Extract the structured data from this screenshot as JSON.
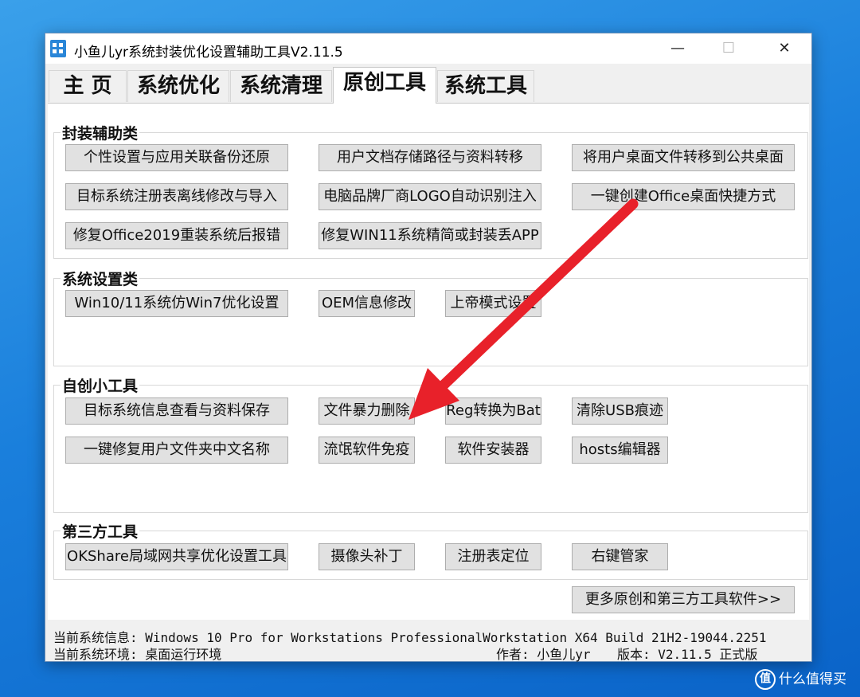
{
  "window": {
    "title": "小鱼儿yr系统封装优化设置辅助工具V2.11.5",
    "minimize_glyph": "—",
    "maximize_glyph": "☐",
    "close_glyph": "✕"
  },
  "tabs": [
    {
      "label": "主 页",
      "active": false
    },
    {
      "label": "系统优化",
      "active": false
    },
    {
      "label": "系统清理",
      "active": false
    },
    {
      "label": "原创工具",
      "active": true
    },
    {
      "label": "系统工具",
      "active": false
    }
  ],
  "groups": {
    "packaging": {
      "title": "封装辅助类",
      "buttons": [
        "个性设置与应用关联备份还原",
        "用户文档存储路径与资料转移",
        "将用户桌面文件转移到公共桌面",
        "目标系统注册表离线修改与导入",
        "电脑品牌厂商LOGO自动识别注入",
        "一键创建Office桌面快捷方式",
        "修复Office2019重装系统后报错",
        "修复WIN11系统精简或封装丢APP"
      ]
    },
    "system_settings": {
      "title": "系统设置类",
      "buttons": [
        "Win10/11系统仿Win7优化设置",
        "OEM信息修改",
        "上帝模式设置"
      ]
    },
    "own_tools": {
      "title": "自创小工具",
      "buttons": [
        "目标系统信息查看与资料保存",
        "文件暴力删除",
        "Reg转换为Bat",
        "清除USB痕迹",
        "一键修复用户文件夹中文名称",
        "流氓软件免疫",
        "软件安装器",
        "hosts编辑器"
      ]
    },
    "third_party": {
      "title": "第三方工具",
      "buttons": [
        "OKShare局域网共享优化设置工具",
        "摄像头补丁",
        "注册表定位",
        "右键管家"
      ]
    }
  },
  "more_button": "更多原创和第三方工具软件>>",
  "status": {
    "system_info": "当前系统信息: Windows 10 Pro for Workstations ProfessionalWorkstation X64 Build 21H2-19044.2251",
    "system_env": "当前系统环境: 桌面运行环境",
    "author": "作者: 小鱼儿yr",
    "version": "版本: V2.11.5 正式版"
  },
  "annotation": {
    "arrow_color": "#e8212a"
  },
  "watermark": {
    "icon_glyph": "值",
    "text": "什么值得买"
  }
}
